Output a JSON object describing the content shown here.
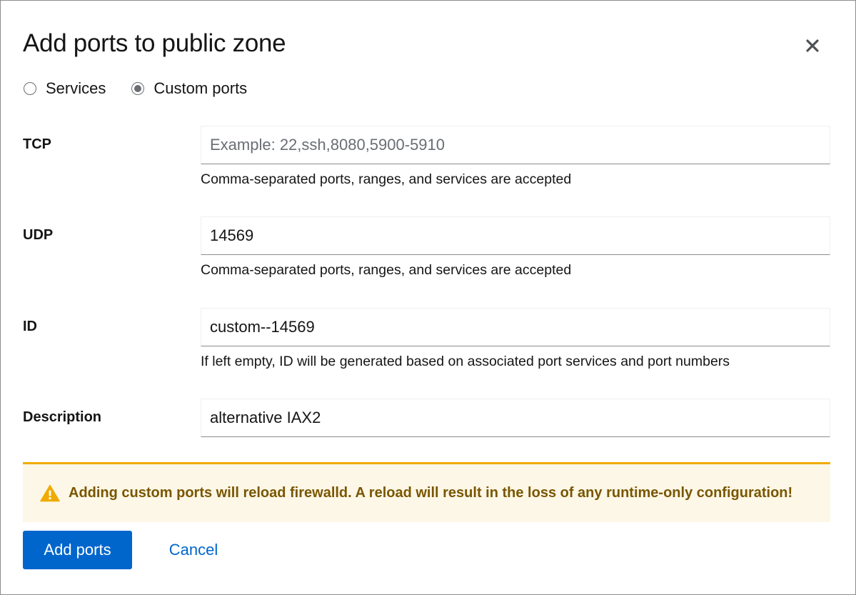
{
  "dialog": {
    "title": "Add ports to public zone"
  },
  "radio_options": {
    "services_label": "Services",
    "custom_ports_label": "Custom ports",
    "selected": "Custom ports"
  },
  "form": {
    "tcp": {
      "label": "TCP",
      "value": "",
      "placeholder": "Example: 22,ssh,8080,5900-5910",
      "helper": "Comma-separated ports, ranges, and services are accepted"
    },
    "udp": {
      "label": "UDP",
      "value": "14569",
      "placeholder": "",
      "helper": "Comma-separated ports, ranges, and services are accepted"
    },
    "id": {
      "label": "ID",
      "value": "custom--14569",
      "helper": "If left empty, ID will be generated based on associated port services and port numbers"
    },
    "description": {
      "label": "Description",
      "value": "alternative IAX2"
    }
  },
  "alert": {
    "icon": "warning-triangle-icon",
    "text": "Adding custom ports will reload firewalld. A reload will result in the loss of any runtime-only configuration!"
  },
  "actions": {
    "add_label": "Add ports",
    "cancel_label": "Cancel"
  },
  "colors": {
    "primary": "#0066cc",
    "warning_border": "#f0ab00",
    "warning_bg": "#fdf7e7",
    "warning_text": "#795600"
  }
}
